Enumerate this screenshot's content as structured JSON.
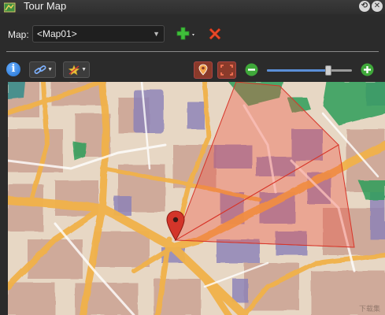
{
  "window": {
    "title": "Tour Map",
    "buttons": [
      "restore-icon",
      "close-icon"
    ]
  },
  "map_row": {
    "label": "Map:",
    "selected_map": "<Map01>"
  },
  "toolbar": {
    "icons": [
      "info-icon",
      "link-icon",
      "star-icon",
      "pin-icon",
      "fit-icon",
      "zoom-out-icon",
      "zoom-in-icon"
    ],
    "zoom_level": 0.72
  },
  "map": {
    "watermark": "下载集",
    "colors": {
      "paper": "#e7d7c4",
      "road": "#f1b24a",
      "water_green": "#2f9e5a",
      "park": "#8a7fb8",
      "block": "#c9a29a",
      "field_of_view": "#f04a3a",
      "pin": "#d3352a"
    }
  }
}
